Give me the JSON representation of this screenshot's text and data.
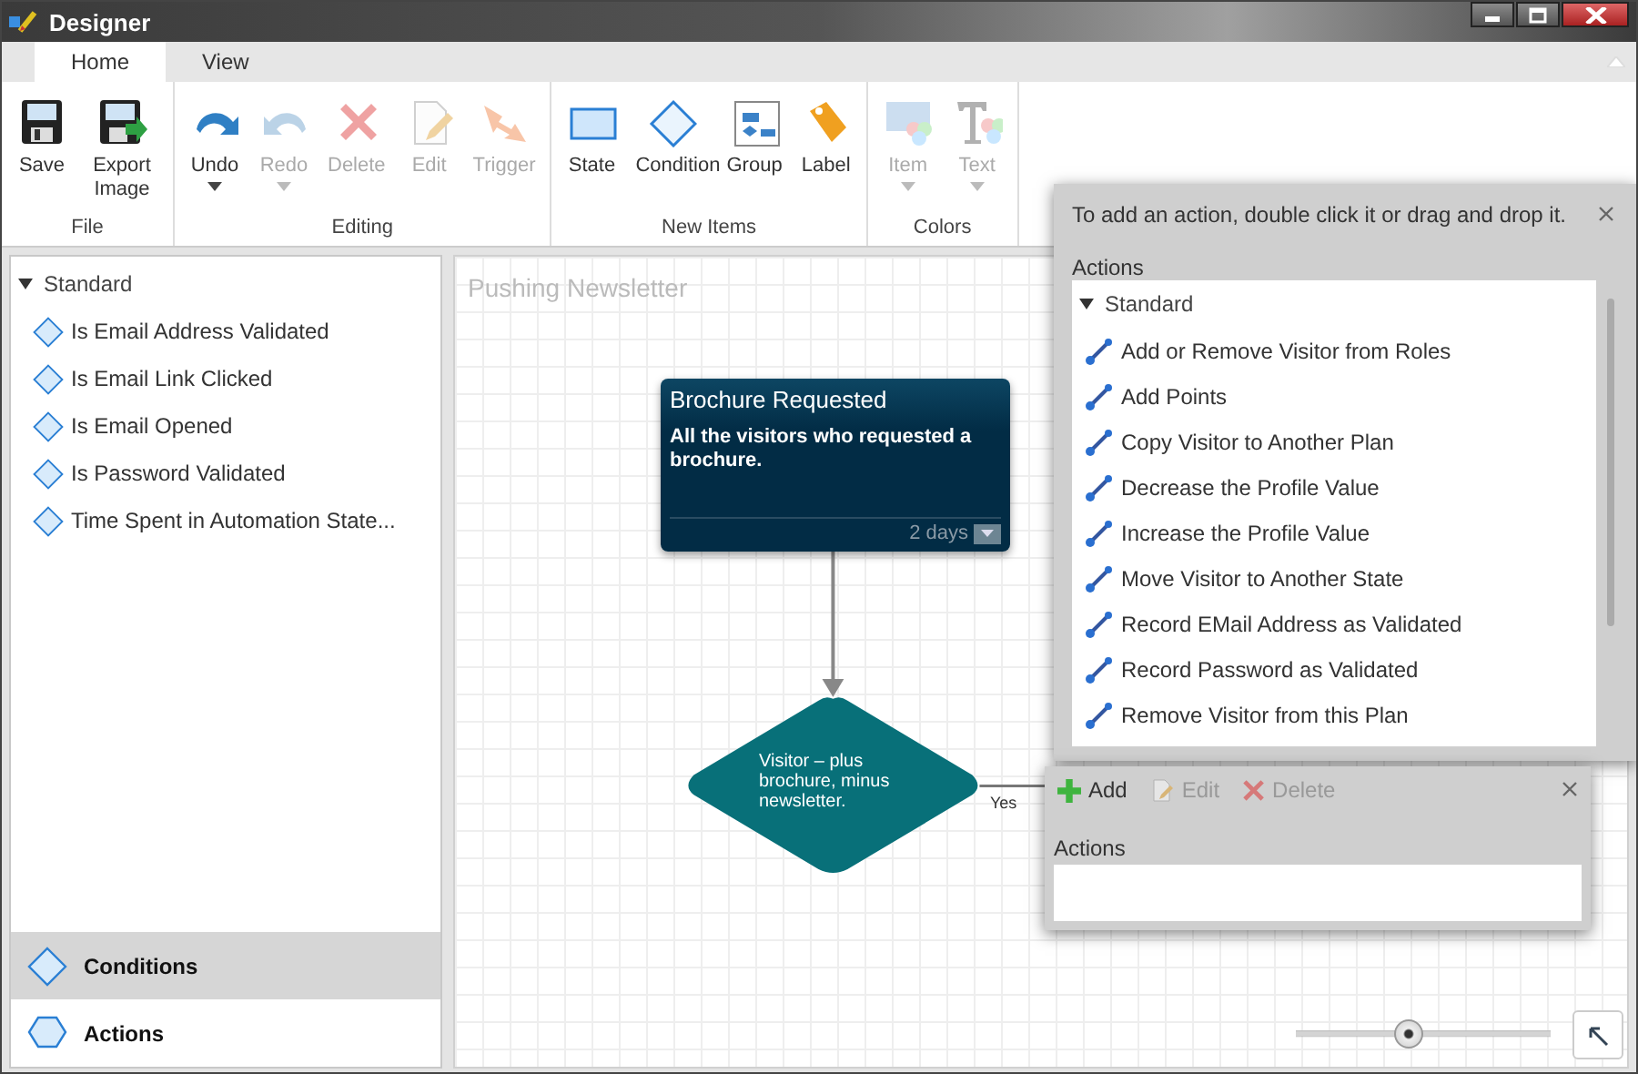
{
  "window": {
    "title": "Designer"
  },
  "tabs": [
    {
      "label": "Home",
      "selected": true
    },
    {
      "label": "View",
      "selected": false
    }
  ],
  "ribbon": {
    "groups": [
      {
        "label": "File",
        "buttons": [
          {
            "kind": "save",
            "label": "Save",
            "disabled": false,
            "dropdown": false
          },
          {
            "kind": "export",
            "label": "Export Image",
            "disabled": false,
            "dropdown": false
          }
        ]
      },
      {
        "label": "Editing",
        "buttons": [
          {
            "kind": "undo",
            "label": "Undo",
            "disabled": false,
            "dropdown": true
          },
          {
            "kind": "redo",
            "label": "Redo",
            "disabled": true,
            "dropdown": true
          },
          {
            "kind": "delete",
            "label": "Delete",
            "disabled": true,
            "dropdown": false
          },
          {
            "kind": "edit",
            "label": "Edit",
            "disabled": true,
            "dropdown": false
          },
          {
            "kind": "trigger",
            "label": "Trigger",
            "disabled": true,
            "dropdown": false
          }
        ]
      },
      {
        "label": "New Items",
        "buttons": [
          {
            "kind": "state",
            "label": "State",
            "disabled": false,
            "dropdown": false
          },
          {
            "kind": "condition",
            "label": "Condition",
            "disabled": false,
            "dropdown": false
          },
          {
            "kind": "group",
            "label": "Group",
            "disabled": false,
            "dropdown": false
          },
          {
            "kind": "label",
            "label": "Label",
            "disabled": false,
            "dropdown": false
          }
        ]
      },
      {
        "label": "Colors",
        "buttons": [
          {
            "kind": "item",
            "label": "Item",
            "disabled": true,
            "dropdown": true
          },
          {
            "kind": "text",
            "label": "Text",
            "disabled": true,
            "dropdown": true
          }
        ]
      }
    ]
  },
  "left_panel": {
    "tree": {
      "label": "Standard",
      "expanded": true,
      "children": [
        {
          "label": "Is Email Address Validated"
        },
        {
          "label": "Is Email Link Clicked"
        },
        {
          "label": "Is Email Opened"
        },
        {
          "label": "Is Password Validated"
        },
        {
          "label": "Time Spent in Automation State..."
        }
      ]
    },
    "sections": [
      {
        "kind": "diamond",
        "label": "Conditions",
        "selected": true
      },
      {
        "kind": "hexagon",
        "label": "Actions",
        "selected": false
      }
    ]
  },
  "canvas": {
    "title": "Pushing Newsletter",
    "state_node": {
      "title": "Brochure Requested",
      "description": "All the visitors who requested a brochure.",
      "duration": "2 days"
    },
    "condition_node": {
      "text": "Visitor – plus brochure, minus newsletter."
    },
    "yes_label": "Yes",
    "zoom": {
      "level": 0.44
    }
  },
  "actions_popup": {
    "hint": "To add an action, double click it or drag and drop it.",
    "label": "Actions",
    "tree": {
      "label": "Standard",
      "expanded": true,
      "children": [
        {
          "label": "Add or Remove Visitor from Roles"
        },
        {
          "label": "Add Points"
        },
        {
          "label": "Copy Visitor to Another Plan"
        },
        {
          "label": "Decrease the Profile Value"
        },
        {
          "label": "Increase the Profile Value"
        },
        {
          "label": "Move Visitor to Another State"
        },
        {
          "label": "Record EMail Address as Validated"
        },
        {
          "label": "Record Password as Validated"
        },
        {
          "label": "Remove Visitor from this Plan"
        }
      ]
    }
  },
  "condition_popup": {
    "buttons": [
      {
        "kind": "add",
        "label": "Add",
        "disabled": false
      },
      {
        "kind": "edit",
        "label": "Edit",
        "disabled": true
      },
      {
        "kind": "delete",
        "label": "Delete",
        "disabled": true
      }
    ],
    "label": "Actions"
  }
}
